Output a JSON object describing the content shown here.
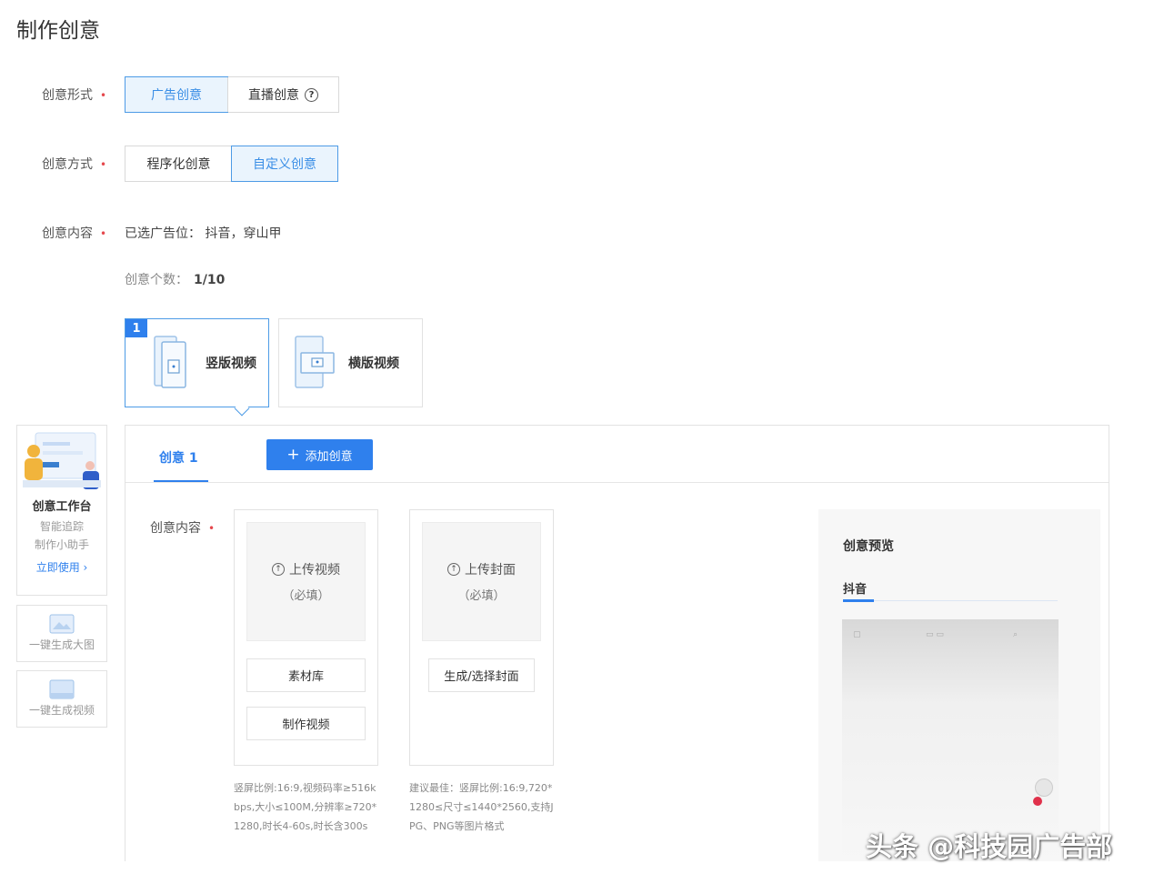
{
  "page": {
    "title": "制作创意"
  },
  "form": {
    "creative_form": {
      "label": "创意形式",
      "options": [
        "广告创意",
        "直播创意"
      ],
      "selected": "广告创意"
    },
    "creative_method": {
      "label": "创意方式",
      "options": [
        "程序化创意",
        "自定义创意"
      ],
      "selected": "自定义创意"
    },
    "creative_content": {
      "label": "创意内容",
      "value": "已选广告位： 抖音，穿山甲"
    },
    "creative_count": {
      "label": "创意个数：",
      "value": "1/10"
    }
  },
  "video_types": [
    {
      "label": "竖版视频",
      "badge": "1"
    },
    {
      "label": "横版视频"
    }
  ],
  "sidebar": {
    "workbench": {
      "title": "创意工作台",
      "line1": "智能追踪",
      "line2": "制作小助手",
      "link": "立即使用 ›"
    },
    "tool1": "一键生成大图",
    "tool2": "一键生成视频"
  },
  "panel": {
    "tab": "创意 1",
    "add_button": "添加创意",
    "content_label": "创意内容",
    "video_upload": {
      "title": "上传视频",
      "required": "（必填）",
      "button1": "素材库",
      "button2": "制作视频",
      "hint": "竖屏比例:16:9,视频码率≥516kbps,大小≤100M,分辨率≥720*1280,时长4-60s,时长含300s"
    },
    "cover_upload": {
      "title": "上传封面",
      "required": "（必填）",
      "button1": "生成/选择封面",
      "hint": "建议最佳：竖屏比例:16:9,720*1280≤尺寸≤1440*2560,支持JPG、PNG等图片格式"
    }
  },
  "preview": {
    "title": "创意预览",
    "tab": "抖音"
  },
  "watermark": "头条 @科技园广告部"
}
